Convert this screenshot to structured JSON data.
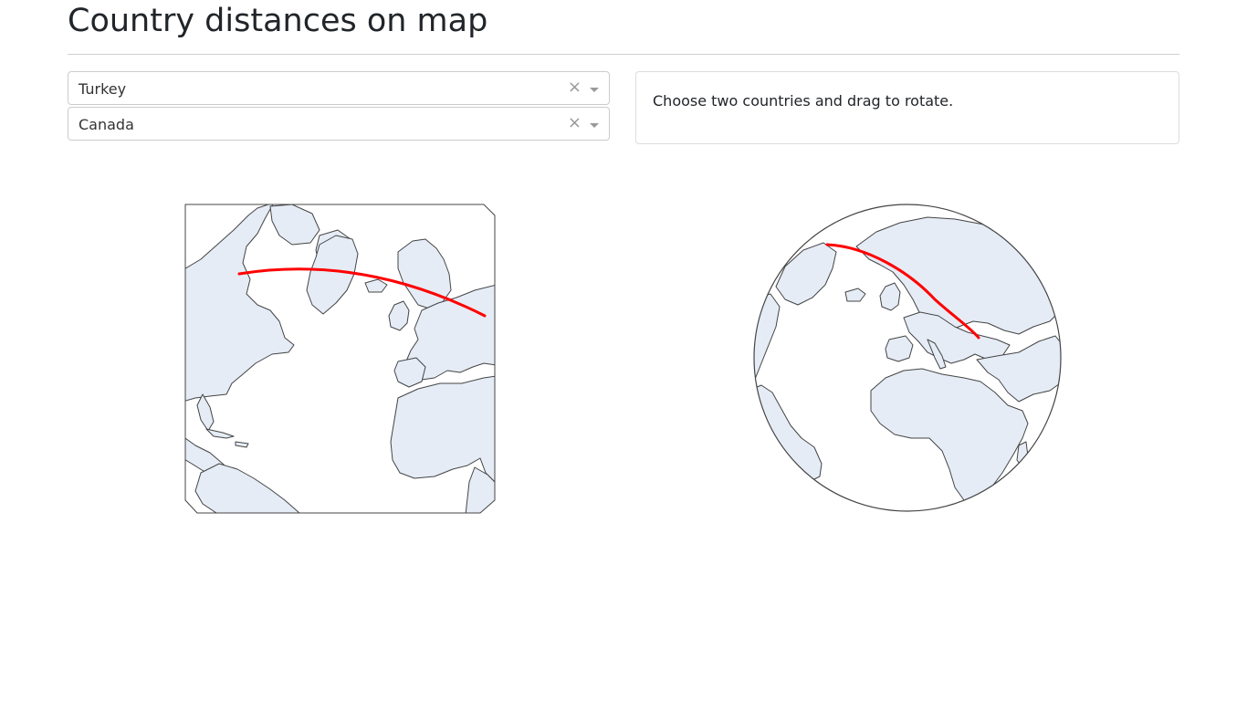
{
  "page": {
    "title": "Country distances on map"
  },
  "selectors": [
    {
      "value": "Turkey",
      "clear_glyph": "×",
      "arrow_icon": "caret-down-icon"
    },
    {
      "value": "Canada",
      "clear_glyph": "×",
      "arrow_icon": "caret-down-icon"
    }
  ],
  "info": {
    "text": "Choose two countries and drag to rotate."
  },
  "maps": [
    {
      "projection": "azimuthal-flat",
      "route_color": "#ff0000",
      "land_color": "#e5ecf6",
      "coast_color": "#444444"
    },
    {
      "projection": "orthographic",
      "route_color": "#ff0000",
      "land_color": "#e5ecf6",
      "coast_color": "#444444"
    }
  ]
}
